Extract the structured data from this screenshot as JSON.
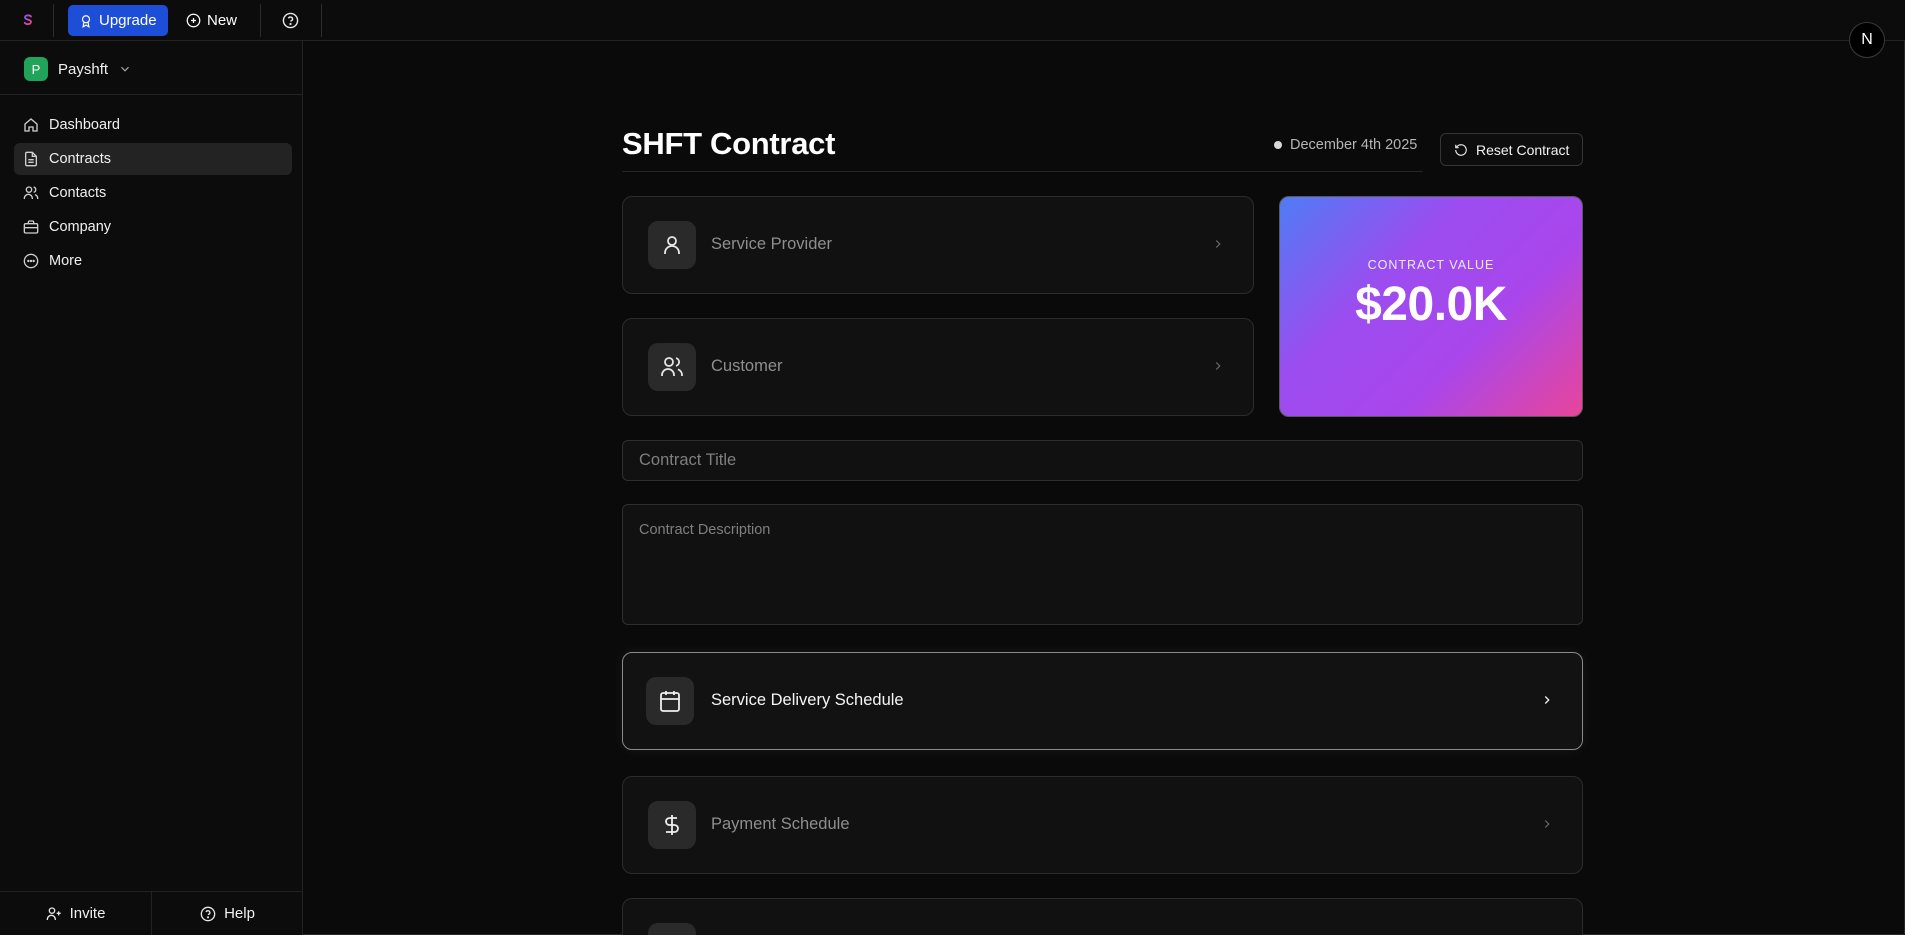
{
  "topbar": {
    "logo_letter": "S",
    "upgrade_label": "Upgrade",
    "new_label": "New",
    "user_initial": "N"
  },
  "sidebar": {
    "workspace": {
      "initial": "P",
      "name": "Payshft"
    },
    "items": [
      {
        "label": "Dashboard",
        "icon": "home-icon"
      },
      {
        "label": "Contracts",
        "icon": "document-icon",
        "active": true
      },
      {
        "label": "Contacts",
        "icon": "users-icon"
      },
      {
        "label": "Company",
        "icon": "briefcase-icon"
      },
      {
        "label": "More",
        "icon": "more-circle-icon"
      }
    ],
    "invite_label": "Invite",
    "help_label": "Help"
  },
  "main": {
    "title": "SHFT Contract",
    "date": "December 4th 2025",
    "reset_label": "Reset Contract",
    "service_provider_label": "Service Provider",
    "customer_label": "Customer",
    "contract_value": {
      "label": "CONTRACT VALUE",
      "amount": "$20.0K"
    },
    "contract_title_placeholder": "Contract Title",
    "contract_description_placeholder": "Contract Description",
    "service_delivery_label": "Service Delivery Schedule",
    "payment_schedule_label": "Payment Schedule"
  },
  "colors": {
    "accent": "#1d4ed8",
    "workspace_badge": "#22a35a",
    "value_gradient": [
      "#4f7cf5",
      "#a946ec",
      "#e8459a"
    ]
  }
}
